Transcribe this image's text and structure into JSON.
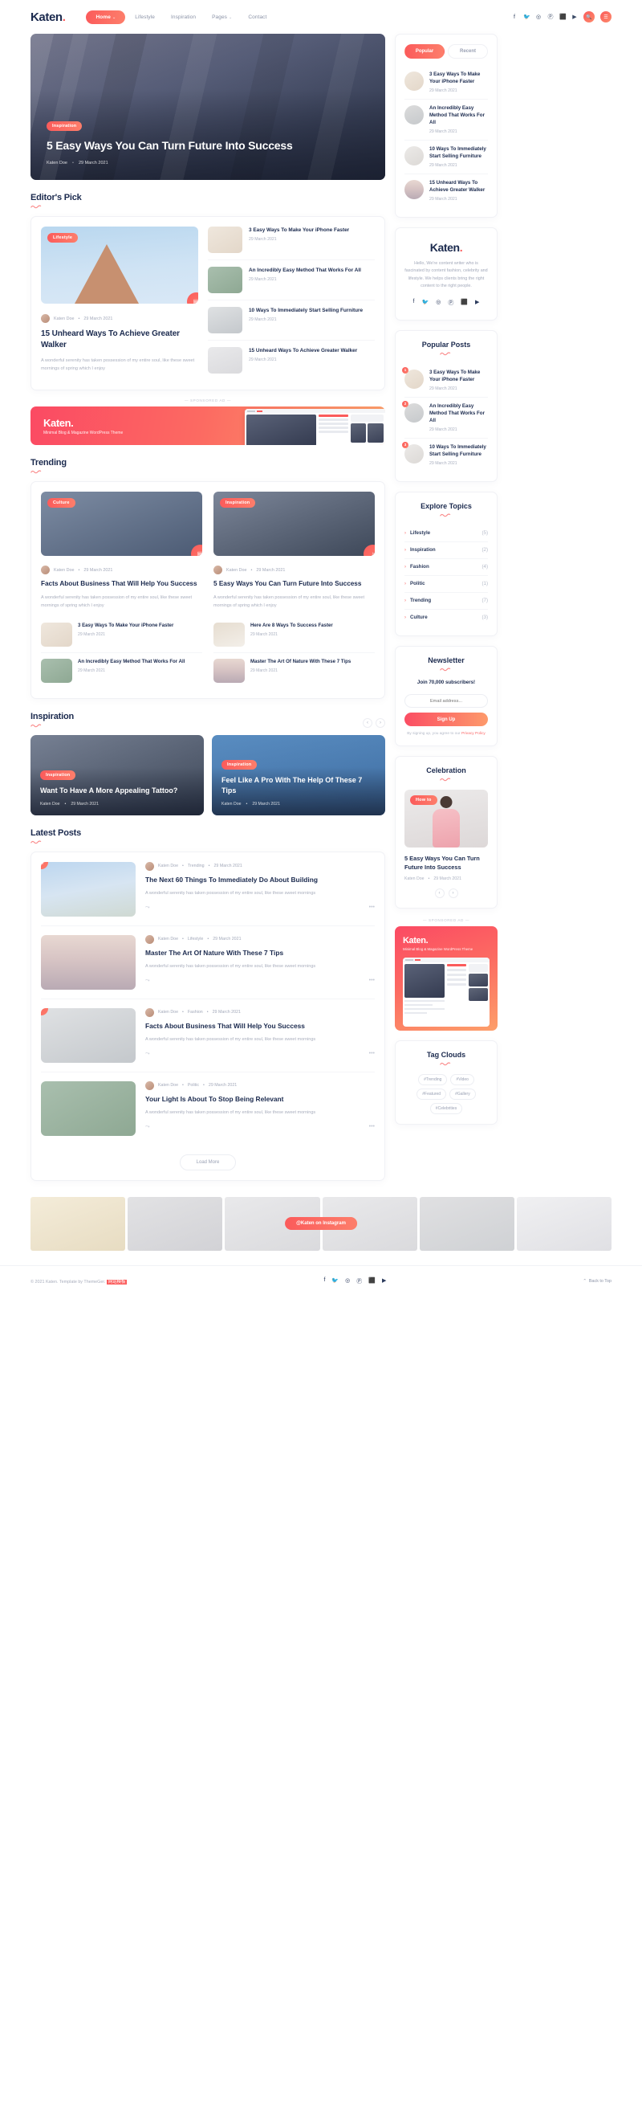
{
  "header": {
    "logo": "Katen",
    "logo_dot": ".",
    "nav": [
      {
        "label": "Home",
        "caret": "⌄",
        "active": true
      },
      {
        "label": "Lifestyle",
        "caret": "",
        "active": false
      },
      {
        "label": "Inspiration",
        "caret": "",
        "active": false
      },
      {
        "label": "Pages",
        "caret": "⌄",
        "active": false
      },
      {
        "label": "Contact",
        "caret": "",
        "active": false
      }
    ],
    "socials": [
      "facebook-icon",
      "twitter-icon",
      "instagram-icon",
      "pinterest-icon",
      "behance-icon",
      "youtube-icon"
    ],
    "social_glyphs": [
      "f",
      "🐦",
      "◎",
      "Ⓟ",
      "⬛",
      "▶"
    ],
    "search_glyph": "🔍",
    "menu_glyph": "☰"
  },
  "hero": {
    "badge": "Inspiration",
    "title": "5 Easy Ways You Can Turn Future Into Success",
    "author": "Katen Doe",
    "sep": "•",
    "date": "29 March 2021"
  },
  "sidebar": {
    "tabs": {
      "popular": "Popular",
      "recent": "Recent"
    },
    "popular_tab_posts": [
      {
        "title": "3 Easy Ways To Make Your iPhone Faster",
        "date": "29 March 2021",
        "thumb": "img-iphone"
      },
      {
        "title": "An Incredibly Easy Method That Works For All",
        "date": "29 March 2021",
        "thumb": "img-woman"
      },
      {
        "title": "10 Ways To Immediately Start Selling Furniture",
        "date": "29 March 2021",
        "thumb": "img-chair"
      },
      {
        "title": "15 Unheard Ways To Achieve Greater Walker",
        "date": "29 March 2021",
        "thumb": "img-bulb"
      }
    ],
    "about": {
      "logo": "Katen",
      "logo_dot": ".",
      "text": "Hello, We're content writer who is fascinated by content fashion, celebrity and lifestyle. We helps clients bring the right content to the right people.",
      "socials": [
        "f",
        "🐦",
        "◎",
        "Ⓟ",
        "⬛",
        "▶"
      ]
    },
    "popular_posts": {
      "title": "Popular Posts",
      "items": [
        {
          "rank": "1",
          "title": "3 Easy Ways To Make Your iPhone Faster",
          "date": "29 March 2021",
          "thumb": "img-iphone"
        },
        {
          "rank": "2",
          "title": "An Incredibly Easy Method That Works For All",
          "date": "29 March 2021",
          "thumb": "img-woman"
        },
        {
          "rank": "3",
          "title": "10 Ways To Immediately Start Selling Furniture",
          "date": "29 March 2021",
          "thumb": "img-chair"
        }
      ]
    },
    "explore": {
      "title": "Explore Topics",
      "items": [
        {
          "label": "Lifestyle",
          "count": "(5)"
        },
        {
          "label": "Inspiration",
          "count": "(2)"
        },
        {
          "label": "Fashion",
          "count": "(4)"
        },
        {
          "label": "Politic",
          "count": "(1)"
        },
        {
          "label": "Trending",
          "count": "(7)"
        },
        {
          "label": "Culture",
          "count": "(3)"
        }
      ],
      "chevron": "›"
    },
    "newsletter": {
      "title": "Newsletter",
      "subtitle": "Join 70,000 subscribers!",
      "placeholder": "Email address...",
      "button": "Sign Up",
      "note_prefix": "By signing up, you agree to our ",
      "note_link": "Privacy Policy"
    },
    "celebration": {
      "title": "Celebration",
      "badge": "How to",
      "post_title": "5 Easy Ways You Can Turn Future Into Success",
      "author": "Katen Doe",
      "sep": "•",
      "date": "29 March 2021",
      "prev": "‹",
      "next": "›"
    },
    "sponsored_label": "— SPONSORED AD —",
    "ad": {
      "logo": "Katen",
      "logo_dot": ".",
      "tagline": "Minimal Blog & Magazine WordPress Theme"
    },
    "tagcloud": {
      "title": "Tag Clouds",
      "tags": [
        "#Trending",
        "#Video",
        "#Featured",
        "#Gallery",
        "#Celebrities"
      ]
    }
  },
  "main": {
    "editors_pick": {
      "title": "Editor's Pick",
      "feature": {
        "badge": "Lifestyle",
        "author": "Katen Doe",
        "sep": "•",
        "date": "29 March 2021",
        "title": "15 Unheard Ways To Achieve Greater Walker",
        "excerpt": "A wonderful serenity has taken possession of my entire soul, like these sweet mornings of spring which I enjoy",
        "fab_icon": "gallery-icon"
      },
      "list": [
        {
          "title": "3 Easy Ways To Make Your iPhone Faster",
          "date": "29 March 2021",
          "thumb": "img-iphone"
        },
        {
          "title": "An Incredibly Easy Method That Works For All",
          "date": "29 March 2021",
          "thumb": "img-lamp"
        },
        {
          "title": "10 Ways To Immediately Start Selling Furniture",
          "date": "29 March 2021",
          "thumb": "img-smile"
        },
        {
          "title": "15 Unheard Ways To Achieve Greater Walker",
          "date": "29 March 2021",
          "thumb": "img-bulb"
        }
      ]
    },
    "sponsored_label": "— SPONSORED AD —",
    "ad": {
      "logo": "Katen",
      "logo_dot": ".",
      "tagline": "Minimal Blog & Magazine WordPress Theme"
    },
    "trending": {
      "title": "Trending",
      "cards": [
        {
          "badge": "Culture",
          "image": "img-person-blue",
          "author": "Katen Doe",
          "sep": "•",
          "date": "29 March 2021",
          "title": "Facts About Business That Will Help You Success",
          "excerpt": "A wonderful serenity has taken possession of my entire soul, like these sweet mornings of spring which I enjoy",
          "sub": [
            {
              "title": "3 Easy Ways To Make Your iPhone Faster",
              "date": "29 March 2021",
              "thumb": "img-iphone"
            },
            {
              "title": "An Incredibly Easy Method That Works For All",
              "date": "29 March 2021",
              "thumb": "img-lamp"
            }
          ]
        },
        {
          "badge": "Inspiration",
          "image": "img-man",
          "author": "Katen Doe",
          "sep": "•",
          "date": "29 March 2021",
          "title": "5 Easy Ways You Can Turn Future Into Success",
          "excerpt": "A wonderful serenity has taken possession of my entire soul, like these sweet mornings of spring which I enjoy",
          "sub": [
            {
              "title": "Here Are 8 Ways To Success Faster",
              "date": "29 March 2021",
              "thumb": "img-bag"
            },
            {
              "title": "Master The Art Of Nature With These 7 Tips",
              "date": "29 March 2021",
              "thumb": "img-sea"
            }
          ]
        }
      ]
    },
    "inspiration": {
      "title": "Inspiration",
      "prev": "‹",
      "next": "›",
      "cards": [
        {
          "badge": "Inspiration",
          "image": "img-man",
          "title": "Want To Have A More Appealing Tattoo?",
          "author": "Katen Doe",
          "sep": "•",
          "date": "29 March 2021"
        },
        {
          "badge": "Inspiration",
          "image": "img-girl",
          "title": "Feel Like A Pro With The Help Of These 7 Tips",
          "author": "Katen Doe",
          "sep": "•",
          "date": "29 March 2021"
        }
      ]
    },
    "latest": {
      "title": "Latest Posts",
      "items": [
        {
          "image": "img-opera",
          "badge": "",
          "author": "Katen Doe",
          "category": "Trending",
          "date": "29 March 2021",
          "title": "The Next 60 Things To Immediately Do About Building",
          "excerpt": "A wonderful serenity has taken possession of my entire soul, like these sweet mornings",
          "share_icon": "share-icon",
          "more_icon": "more-icon"
        },
        {
          "image": "img-sea",
          "badge": "",
          "author": "Katen Doe",
          "category": "Lifestyle",
          "date": "29 March 2021",
          "title": "Master The Art Of Nature With These 7 Tips",
          "excerpt": "A wonderful serenity has taken possession of my entire soul, like these sweet mornings",
          "share_icon": "share-icon",
          "more_icon": "more-icon"
        },
        {
          "image": "img-smile",
          "badge": "",
          "author": "Katen Doe",
          "category": "Fashion",
          "date": "29 March 2021",
          "title": "Facts About Business That Will Help You Success",
          "excerpt": "A wonderful serenity has taken possession of my entire soul, like these sweet mornings",
          "share_icon": "share-icon",
          "more_icon": "more-icon"
        },
        {
          "image": "img-lamp",
          "badge": "",
          "author": "Katen Doe",
          "category": "Politic",
          "date": "29 March 2021",
          "title": "Your Light Is About To Stop Being Relevant",
          "excerpt": "A wonderful serenity has taken possession of my entire soul, like these sweet mornings",
          "share_icon": "share-icon",
          "more_icon": "more-icon"
        }
      ],
      "load_more": "Load More"
    }
  },
  "instagram": {
    "button": "@Katen on Instagram",
    "cells": [
      "img-glasses",
      "img-note",
      "img-bulb",
      "img-bulb",
      "img-sit",
      "img-spoon"
    ]
  },
  "footer": {
    "copyright_prefix": "© 2021 Katen. Template by ThemeGer. ",
    "copyright_cn": "网站模板",
    "socials": [
      "f",
      "🐦",
      "◎",
      "Ⓟ",
      "⬛",
      "▶"
    ],
    "back_to_top": "Back to Top",
    "back_arrow": "⌃"
  },
  "colors": {
    "accent": "#fb5b5b",
    "accent2": "#fd8a6b",
    "ink": "#1b2a4e",
    "muted": "#a9aebd"
  }
}
